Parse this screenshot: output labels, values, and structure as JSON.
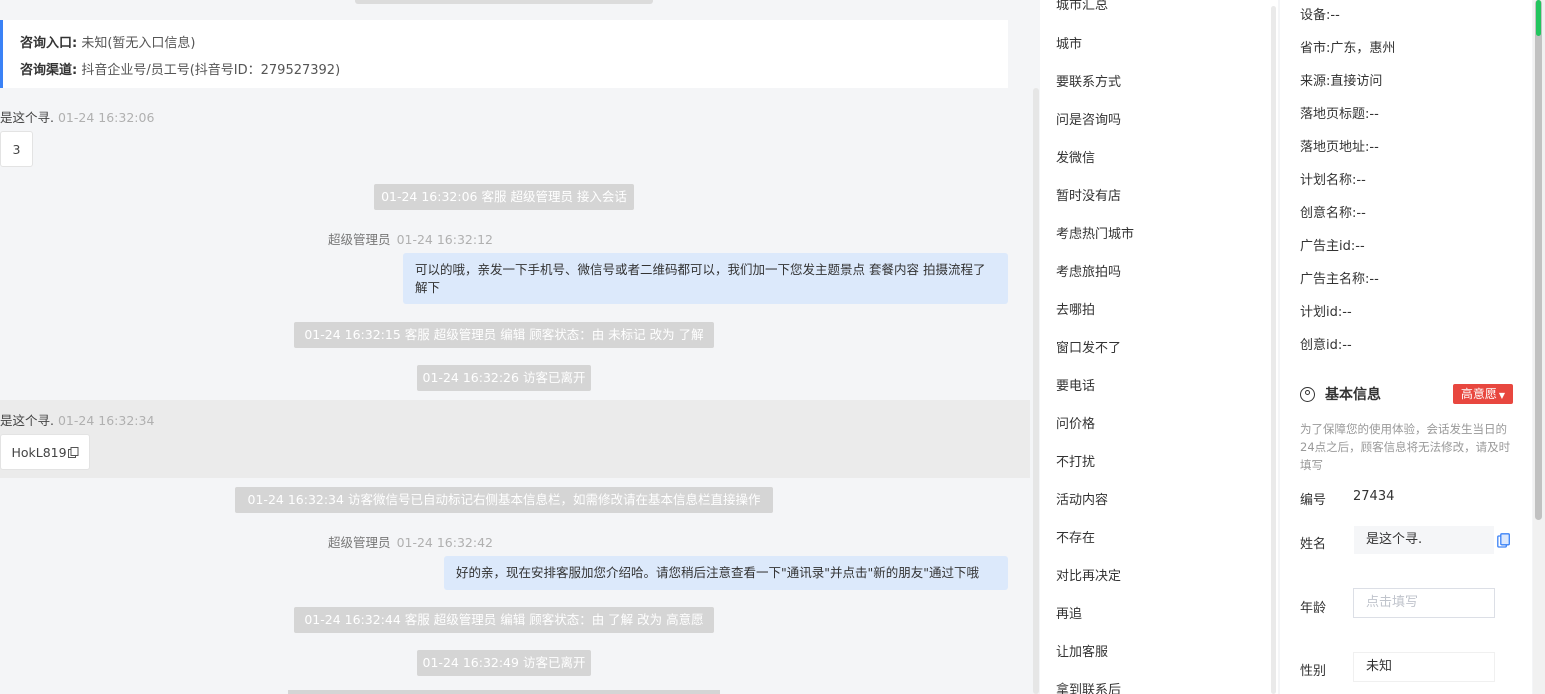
{
  "chat": {
    "entry_label": "咨询入口:",
    "entry_value": "未知(暂无入口信息)",
    "channel_label": "咨询渠道:",
    "channel_value": "抖音企业号/员工号(抖音号ID：279527392)",
    "messages": [
      {
        "visitor": "是这个寻.",
        "time": "01-24 16:32:06",
        "content": "3"
      },
      {
        "system": "01-24 16:32:06 客服 超级管理员 接入会话"
      },
      {
        "agent": "超级管理员",
        "time": "01-24 16:32:12",
        "content": "可以的哦，亲发一下手机号、微信号或者二维码都可以，我们加一下您发主题景点 套餐内容 拍摄流程了解下"
      },
      {
        "system": "01-24 16:32:15 客服 超级管理员 编辑 顾客状态：由 未标记 改为 了解"
      },
      {
        "system": "01-24 16:32:26 访客已离开"
      },
      {
        "visitor": "是这个寻.",
        "time": "01-24 16:32:34",
        "content": "HokL819"
      },
      {
        "system": "01-24 16:32:34 访客微信号已自动标记右侧基本信息栏，如需修改请在基本信息栏直接操作"
      },
      {
        "agent": "超级管理员",
        "time": "01-24 16:32:42",
        "content": "好的亲，现在安排客服加您介绍哈。请您稍后注意查看一下\"通讯录\"并点击\"新的朋友\"通过下哦"
      },
      {
        "system": "01-24 16:32:44 客服 超级管理员 编辑 顾客状态：由 了解 改为 高意愿"
      },
      {
        "system": "01-24 16:32:49 访客已离开"
      }
    ]
  },
  "quick_replies": [
    "城市汇总",
    "城市",
    "要联系方式",
    "问是咨询吗",
    "发微信",
    "暂时没有店",
    "考虑热门城市",
    "考虑旅拍吗",
    "去哪拍",
    "窗口发不了",
    "要电话",
    "问价格",
    "不打扰",
    "活动内容",
    "不存在",
    "对比再决定",
    "再追",
    "让加客服",
    "拿到联系后"
  ],
  "panel": {
    "source_fields": [
      {
        "label": "设备:",
        "value": "--"
      },
      {
        "label": "省市:",
        "value": "广东，惠州"
      },
      {
        "label": "来源:",
        "value": "直接访问"
      },
      {
        "label": "落地页标题:",
        "value": "--"
      },
      {
        "label": "落地页地址:",
        "value": "--"
      },
      {
        "label": "计划名称:",
        "value": "--"
      },
      {
        "label": "创意名称:",
        "value": "--"
      },
      {
        "label": "广告主id:",
        "value": "--"
      },
      {
        "label": "广告主名称:",
        "value": "--"
      },
      {
        "label": "计划id:",
        "value": "--"
      },
      {
        "label": "创意id:",
        "value": "--"
      }
    ],
    "basic_title": "基本信息",
    "intent_tag": "高意愿",
    "note": "为了保障您的使用体验，会话发生当日的24点之后，顾客信息将无法修改，请及时填写",
    "id_label": "编号",
    "id_value": "27434",
    "name_label": "姓名",
    "name_value": "是这个寻.",
    "age_label": "年龄",
    "age_placeholder": "点击填写",
    "gender_label": "性别",
    "gender_value": "未知"
  },
  "colors": {
    "accent": "#3b82f6",
    "bubble": "#dce9fb",
    "tag": "#e8473f",
    "system": "#d5d5d5"
  }
}
